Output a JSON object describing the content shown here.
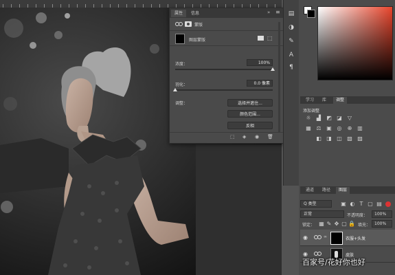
{
  "properties_panel": {
    "tabs": [
      "属性",
      "信息"
    ],
    "subtitle": "蒙版",
    "mask_type": "图层蒙版",
    "density_label": "浓度：",
    "density_value": "100%",
    "density_level": 1.0,
    "feather_label": "羽化：",
    "feather_value": "0.0 像素",
    "feather_level": 0.0,
    "adjust_label": "调整：",
    "buttons": [
      "选择并遮住...",
      "颜色范围...",
      "反相"
    ]
  },
  "color_panel": {
    "fg": "#ffffff",
    "bg": "#000000",
    "hue": "#e8452c"
  },
  "adjustments_panel": {
    "tabs": [
      "学习",
      "库",
      "调整"
    ],
    "title": "添加调整"
  },
  "layers_panel": {
    "tabs": [
      "通道",
      "路径",
      "图层"
    ],
    "filter_label": "Q 类型",
    "blend_mode": "正常",
    "opacity_label": "不透明度：",
    "opacity_value": "100%",
    "lock_label": "锁定：",
    "fill_label": "填充：",
    "fill_value": "100%",
    "layers": [
      {
        "name": "衣服+头发",
        "visible": true
      },
      {
        "name": "皮肤",
        "visible": true
      }
    ]
  },
  "watermark": "百家号/花好你也好"
}
